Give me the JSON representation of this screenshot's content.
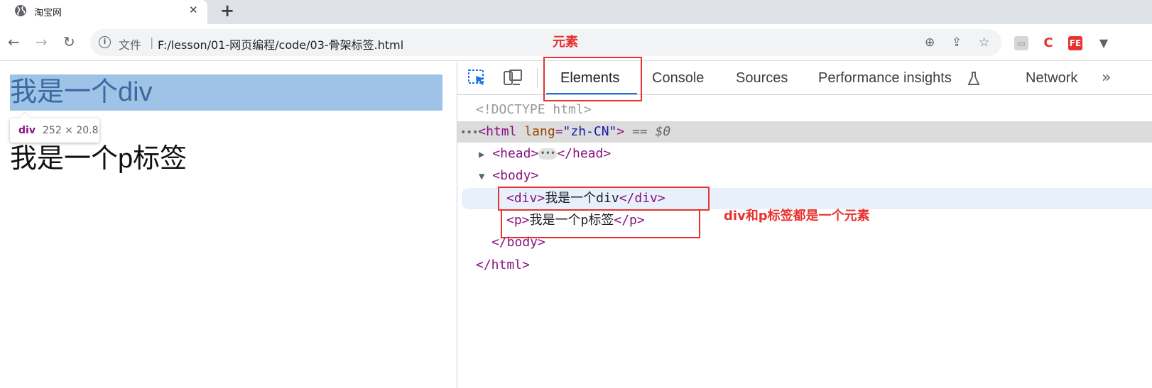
{
  "browser": {
    "tab": {
      "title": "淘宝网",
      "close": "✕"
    },
    "new_tab": "+",
    "address": {
      "info": "i",
      "file_label": "文件",
      "separator": "|",
      "url": "F:/lesson/01-网页编程/code/03-骨架标签.html"
    },
    "extensions": [
      "C",
      "FE"
    ]
  },
  "page": {
    "div_text": "我是一个div",
    "tooltip": {
      "tag": "div",
      "dims": "252 × 20.8"
    },
    "p_text": "我是一个p标签"
  },
  "devtools": {
    "tabs": [
      "Elements",
      "Console",
      "Sources",
      "Performance insights",
      "Network"
    ],
    "active_tab": "Elements",
    "more": "»",
    "dom": {
      "doctype": "<!DOCTYPE html>",
      "html_open": "<html",
      "lang_attr": "lang",
      "lang_val": "\"zh-CN\"",
      "html_close_bracket": ">",
      "selected_marker": "== $0",
      "head_open": "<head>",
      "head_close": "</head>",
      "body_open": "<body>",
      "div_open": "<div>",
      "div_text": "我是一个div",
      "div_close": "</div>",
      "p_open": "<p>",
      "p_text": "我是一个p标签",
      "p_close": "</p>",
      "body_close": "</body>",
      "html_close": "</html>"
    }
  },
  "annotations": {
    "element_label": "元素",
    "div_p_note": "div和p标签都是一个元素",
    "color": "#e8322f"
  }
}
